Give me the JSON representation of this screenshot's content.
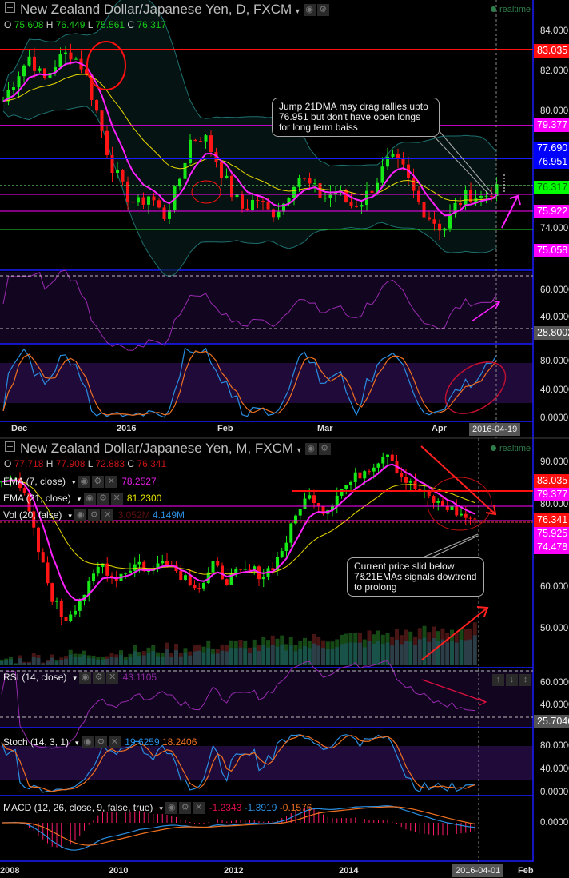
{
  "top_chart": {
    "title": "New Zealand Dollar/Japanese Yen, D, FXCM",
    "ohlc": {
      "o_label": "O",
      "o": "75.608",
      "h_label": "H",
      "h": "76.449",
      "l_label": "L",
      "l": "75.561",
      "c_label": "C",
      "c": "76.317"
    },
    "realtime": "realtime",
    "axis_ticks": [
      "84.000",
      "82.000",
      "80.000",
      "74.000"
    ],
    "price_tags": [
      {
        "value": "83.035",
        "color": "#ff1010"
      },
      {
        "value": "79.377",
        "color": "#ff00ff"
      },
      {
        "value": "77.690",
        "color": "#0000ff"
      },
      {
        "value": "76.951",
        "color": "#0000ff"
      },
      {
        "value": "76.317",
        "color": "#00ff00"
      },
      {
        "value": "75.922",
        "color": "#ff00ff"
      },
      {
        "value": "75.058",
        "color": "#ff00ff"
      }
    ],
    "rsi_ticks": [
      "60.0000",
      "40.0000"
    ],
    "rsi_tag": "28.8002",
    "stoch_ticks": [
      "80.0000",
      "40.0000",
      "0.0000"
    ],
    "x_labels": [
      "Dec",
      "2016",
      "Feb",
      "Mar",
      "Apr"
    ],
    "cursor_date": "2016-04-19",
    "annotation": "Jump 21DMA may drag rallies upto 76.951 but don't have open longs for long term baiss"
  },
  "bottom_chart": {
    "title": "New Zealand Dollar/Japanese Yen, M, FXCM",
    "ohlc": {
      "o_label": "O",
      "o": "77.718",
      "h_label": "H",
      "h": "77.908",
      "l_label": "L",
      "l": "72.883",
      "c_label": "C",
      "c": "76.341"
    },
    "realtime": "realtime",
    "indicators": [
      {
        "label": "EMA (7, close)",
        "values": [
          "78.2527"
        ],
        "colors": [
          "#e020e0"
        ]
      },
      {
        "label": "EMA (21, close)",
        "values": [
          "81.2300"
        ],
        "colors": [
          "#e8e800"
        ]
      },
      {
        "label": "Vol (20, false)",
        "values": [
          "3.052M",
          "4.149M"
        ],
        "colors": [
          "#5a1010",
          "#2a8ee0"
        ]
      }
    ],
    "axis_ticks": [
      "90.000",
      "80.000",
      "60.000",
      "50.000"
    ],
    "price_tags": [
      {
        "value": "83.035",
        "color": "#ff1010"
      },
      {
        "value": "79.377",
        "color": "#ff00ff"
      },
      {
        "value": "76.341",
        "color": "#ff1010"
      },
      {
        "value": "75.925",
        "color": "#ff00ff"
      },
      {
        "value": "74.478",
        "color": "#ff00ff"
      }
    ],
    "rsi": {
      "label": "RSI (14, close)",
      "value": "43.1105",
      "ticks": [
        "60.0000",
        "40.0000"
      ],
      "tag": "25.7046"
    },
    "stoch": {
      "label": "Stoch (14, 3, 1)",
      "k": "19.6259",
      "d": "18.2406",
      "ticks": [
        "80.0000",
        "40.0000",
        "0.0000"
      ]
    },
    "macd": {
      "label": "MACD (12, 26, close, 9, false, true)",
      "hist": "-1.2343",
      "macd": "-1.3919",
      "signal": "-0.1576",
      "ticks": [
        "0.0000"
      ]
    },
    "x_labels": [
      "2008",
      "2010",
      "2012",
      "2014",
      "Feb"
    ],
    "cursor_date": "2016-04-01",
    "annotation": "Current price slid below 7&21EMAs signals dowtrend to prolong"
  },
  "chart_data": [
    {
      "type": "candlestick",
      "title": "NZD/JPY Daily",
      "x_start": "2015-11-24",
      "x_end": "2016-04-19",
      "close_anchors": [
        80.5,
        81.8,
        82.8,
        81.5,
        82.5,
        83.0,
        82.2,
        80.0,
        77.5,
        76.0,
        75.2,
        75.8,
        74.6,
        76.0,
        78.5,
        78.8,
        77.5,
        76.0,
        75.0,
        75.6,
        74.8,
        75.3,
        76.8,
        76.2,
        75.6,
        76.0,
        75.2,
        75.5,
        76.5,
        77.6,
        77.0,
        75.5,
        74.6,
        74.0,
        75.3,
        75.8,
        75.6,
        76.3
      ]
    },
    {
      "type": "candlestick",
      "title": "NZD/JPY Monthly",
      "x_start": "2007-10",
      "x_end": "2016-04",
      "close_anchors": [
        85,
        88,
        80,
        68,
        58,
        52,
        56,
        60,
        66,
        62,
        64,
        66,
        63,
        68,
        64,
        62,
        60,
        65,
        62,
        63,
        64,
        63,
        66,
        72,
        80,
        82,
        78,
        83,
        85,
        88,
        90,
        93,
        87,
        84,
        82,
        80,
        79,
        77,
        76.3
      ]
    }
  ]
}
